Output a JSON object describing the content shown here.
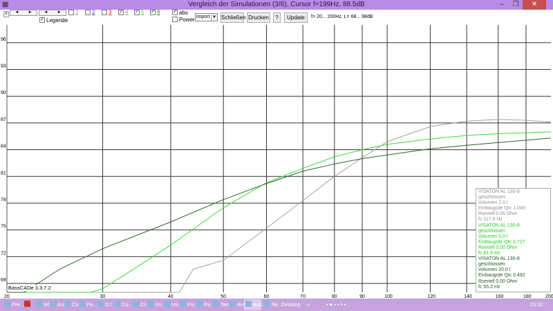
{
  "window": {
    "title": "Vergleich der Simulationen (3/6), Cursor f=199Hz, 88.5dB",
    "minimize": "–",
    "maximize": "❐",
    "close": "✕"
  },
  "toolbar": {
    "checkboxes": [
      {
        "label": "1",
        "checked": false,
        "color": "#999999"
      },
      {
        "label": "2",
        "checked": false,
        "color": "#3030c0"
      },
      {
        "label": "3",
        "checked": false,
        "color": "#e02020"
      },
      {
        "label": "4",
        "checked": true,
        "color": "#9a9a9a"
      },
      {
        "label": "5",
        "checked": true,
        "color": "#33dd33"
      },
      {
        "label": "6",
        "checked": true,
        "color": "#227722"
      }
    ],
    "legende_label": "Legende",
    "abs_label": "abs",
    "power_label": "Power",
    "select_value": "import",
    "close_label": "Schließen",
    "print_label": "Drucken",
    "help_label": "?",
    "update_label": "Update",
    "range_text": "f= 20... 200Hz, L= 68... 98dB"
  },
  "chart_data": {
    "type": "line",
    "xscale": "log",
    "xlim": [
      20,
      200
    ],
    "ylim": [
      68,
      98
    ],
    "x_ticks": [
      20,
      30,
      40,
      50,
      60,
      70,
      80,
      90,
      100,
      120,
      140,
      160,
      180,
      200
    ],
    "y_ticks": [
      69,
      72,
      75,
      78,
      81,
      84,
      87,
      90,
      93,
      96
    ],
    "grid": true,
    "series": [
      {
        "name": "VISATON AL 130-8 2.0 l",
        "color": "#a0a0a0",
        "x": [
          41.5,
          44,
          50,
          60,
          70,
          80,
          90,
          100,
          120,
          140,
          160,
          180,
          200
        ],
        "y": [
          68,
          70.6,
          71.6,
          75.2,
          78.3,
          81.0,
          83.1,
          84.9,
          86.6,
          87.2,
          87.4,
          87.3,
          87.1
        ]
      },
      {
        "name": "VISATON AL 130-8 5.0 l",
        "color": "#33dd33",
        "x": [
          28.5,
          30,
          35,
          40,
          50,
          60,
          70,
          80,
          90,
          100,
          120,
          140,
          160,
          200
        ],
        "y": [
          68,
          68.4,
          71,
          73.3,
          77.5,
          80.3,
          81.9,
          83.2,
          84.0,
          84.6,
          85.2,
          85.6,
          85.8,
          86.0
        ]
      },
      {
        "name": "VISATON AL 130-8 20.0 l",
        "color": "#226622",
        "x": [
          21.5,
          25,
          30,
          40,
          50,
          60,
          70,
          80,
          90,
          100,
          120,
          140,
          160,
          200
        ],
        "y": [
          68,
          70.6,
          72.9,
          75.9,
          78.4,
          80.2,
          81.6,
          82.4,
          83.0,
          83.4,
          84.1,
          84.5,
          84.8,
          85.3
        ]
      }
    ]
  },
  "legend": [
    {
      "color": "#8f8f8f",
      "lines": [
        "VISATON AL 130-8",
        "geschlossen",
        "Volumen 2.0 l",
        "Einbaugüte Qtc 1.049",
        "Rseriell 0.00 Ohm",
        "fc 117.8 Hz"
      ]
    },
    {
      "color": "#22cc22",
      "lines": [
        "VISATON AL 130-8",
        "geschlossen",
        "Volumen 5.0 l",
        "Einbaugüte Qtc 0.727",
        "Rseriell 0.00 Ohm",
        "fc 81.6 Hz"
      ]
    },
    {
      "color": "#1c5a1c",
      "lines": [
        "VISATON AL 130-8",
        "geschlossen",
        "Volumen 20.0 l",
        "Einbaugüte Qtc 0.492",
        "Rseriell 0.00 Ohm",
        "fc 55.2 Hz"
      ]
    }
  ],
  "version": "BassCADe 3.3.7.2",
  "taskbar": {
    "items": [
      "Pre...",
      "",
      "Wi...",
      "Arc...",
      "Co...",
      "Pa...",
      "D:\\",
      "Co...",
      "Co...",
      "Un...",
      "Un...",
      "Pa...",
      "Pa...",
      "Tas...",
      "AH...",
      "Bas...",
      "Ne..."
    ],
    "desktop": "Desktop",
    "overflow": "»",
    "clock": "03:32"
  }
}
